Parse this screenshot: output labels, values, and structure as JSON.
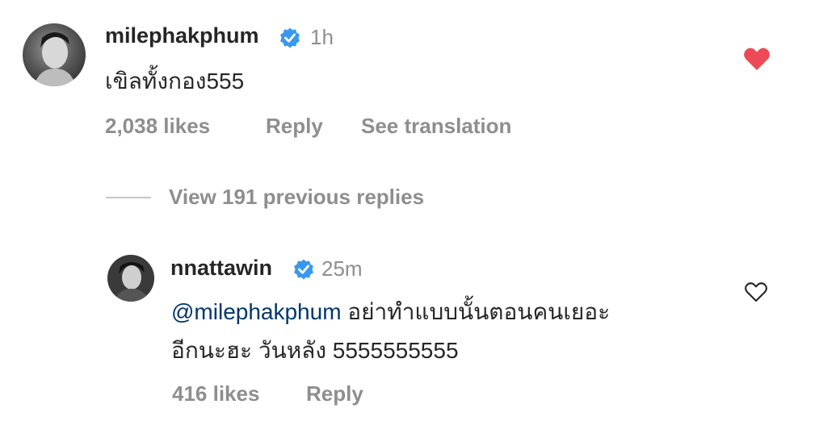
{
  "comment": {
    "username": "milephakphum",
    "time": "1h",
    "text": "เขิลทั้งกอง555",
    "likes": "2,038 likes",
    "reply_label": "Reply",
    "translation_label": "See translation",
    "liked": true
  },
  "view_replies_label": "View 191 previous replies",
  "reply": {
    "username": "nnattawin",
    "time": "25m",
    "mention": "@milephakphum",
    "text_line1_rest": " อย่าทำแบบนั้นตอนคนเยอะ",
    "text_line2": "อีกนะฮะ วันหลัง 5555555555",
    "likes": "416 likes",
    "reply_label": "Reply",
    "liked": false
  },
  "colors": {
    "liked_heart": "#ed4956",
    "verified_badge": "#3897f0",
    "mention": "#00376b",
    "muted_text": "#8e8e8e"
  },
  "icons": {
    "verified": "verified-badge-icon",
    "liked": "heart-filled-icon",
    "unliked": "heart-outline-icon"
  }
}
